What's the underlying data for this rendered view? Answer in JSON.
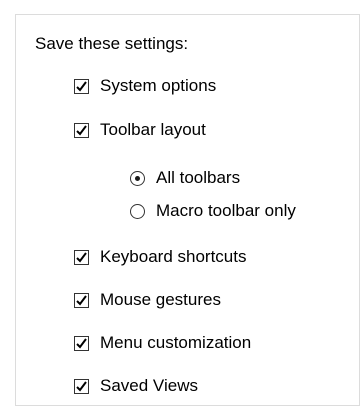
{
  "heading": "Save these settings:",
  "options": {
    "system_options": {
      "label": "System options",
      "checked": true
    },
    "toolbar_layout": {
      "label": "Toolbar layout",
      "checked": true
    },
    "toolbar_scope": {
      "all_toolbars": {
        "label": "All toolbars",
        "selected": true
      },
      "macro_toolbar_only": {
        "label": "Macro toolbar only",
        "selected": false
      }
    },
    "keyboard_shortcuts": {
      "label": "Keyboard shortcuts",
      "checked": true
    },
    "mouse_gestures": {
      "label": "Mouse gestures",
      "checked": true
    },
    "menu_customization": {
      "label": "Menu customization",
      "checked": true
    },
    "saved_views": {
      "label": "Saved Views",
      "checked": true
    }
  },
  "icons": {
    "checkbox_checked": "checkmark-icon",
    "radio_selected": "radio-dot-icon"
  },
  "colors": {
    "background": "#ffffff",
    "text": "#000000",
    "control_border": "#333333",
    "check_mark": "#000000"
  }
}
